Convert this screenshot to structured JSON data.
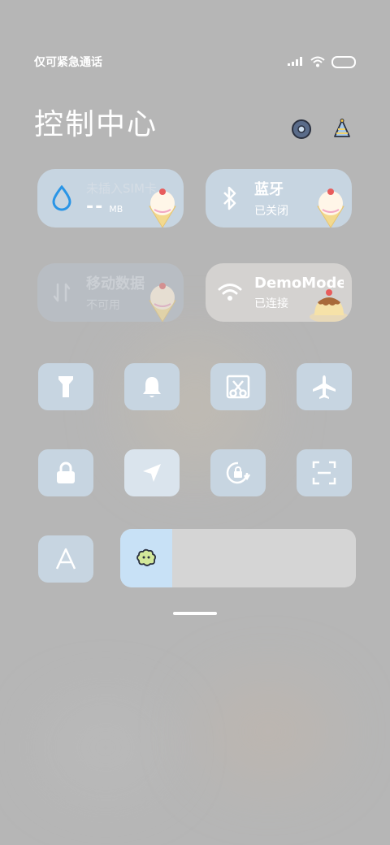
{
  "status_bar": {
    "carrier": "仅可紧急通话",
    "icons": [
      "signal-icon",
      "wifi-icon",
      "battery-icon"
    ]
  },
  "header": {
    "title": "控制中心",
    "icons": [
      "settings-icon",
      "edit-icon"
    ]
  },
  "tiles": {
    "data_usage": {
      "title": "未插入SIM卡",
      "value": "--",
      "unit": "MB",
      "icon": "water-drop-icon"
    },
    "bluetooth": {
      "title": "蓝牙",
      "status": "已关闭",
      "icon": "bluetooth-icon"
    },
    "mobile_data": {
      "title": "移动数据",
      "status": "不可用",
      "icon": "data-arrows-icon"
    },
    "wifi": {
      "title": "DemoMode",
      "status": "已连接",
      "icon": "wifi-icon"
    }
  },
  "toggles": [
    {
      "name": "flashlight",
      "icon": "flashlight-icon",
      "active": false
    },
    {
      "name": "mute",
      "icon": "bell-icon",
      "active": false
    },
    {
      "name": "screenshot",
      "icon": "scissors-icon",
      "active": false
    },
    {
      "name": "airplane",
      "icon": "airplane-icon",
      "active": false
    },
    {
      "name": "lock",
      "icon": "lock-icon",
      "active": false
    },
    {
      "name": "location",
      "icon": "location-arrow-icon",
      "active": true
    },
    {
      "name": "auto-rotate",
      "icon": "rotate-lock-icon",
      "active": false
    },
    {
      "name": "scanner",
      "icon": "scan-icon",
      "active": false
    },
    {
      "name": "auto-brightness",
      "icon": "letter-a-icon",
      "active": false
    }
  ],
  "brightness": {
    "level": 0.22,
    "icon": "brightness-flower-icon"
  },
  "colors": {
    "tile": "#c7d5e1",
    "active_tile": "#dae4ed",
    "slider_fill": "#c8e1f6",
    "accent_blue": "#2a95e6"
  }
}
